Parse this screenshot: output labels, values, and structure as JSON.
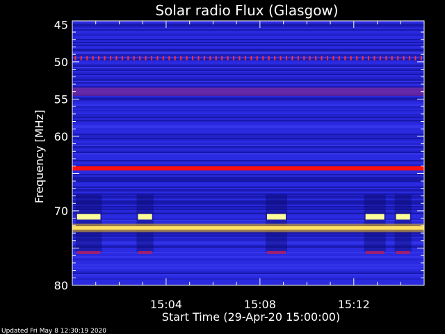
{
  "chart_data": {
    "type": "heatmap",
    "title": "Solar radio Flux (Glasgow)",
    "xlabel": "Start Time (29-Apr-20 15:00:00)",
    "ylabel": "Frequency [MHz]",
    "x_unit": "minutes after 15:00",
    "xlim": [
      0,
      15.0
    ],
    "ylim": [
      80,
      44.5
    ],
    "y_reversed": true,
    "x_ticks": [
      {
        "value": 4,
        "label": "15:04"
      },
      {
        "value": 8,
        "label": "15:08"
      },
      {
        "value": 12,
        "label": "15:12"
      }
    ],
    "y_ticks": [
      {
        "value": 45,
        "label": "45"
      },
      {
        "value": 50,
        "label": "50"
      },
      {
        "value": 55,
        "label": "55"
      },
      {
        "value": 60,
        "label": "60"
      },
      {
        "value": 70,
        "label": "70"
      },
      {
        "value": 80,
        "label": "80"
      }
    ],
    "background_color": "#2a2ae0",
    "bands": [
      {
        "freq": 54.0,
        "color": "#7a2a9a",
        "intensity": "medium"
      },
      {
        "freq": 64.3,
        "color": "#ff1010",
        "intensity": "high"
      },
      {
        "freq": 72.3,
        "color": "#ffe060",
        "intensity": "very high"
      }
    ],
    "periodic_spikes": {
      "freq": 49.5,
      "color": "#ff3030"
    },
    "bursts": [
      {
        "start": 0.2,
        "end": 1.2,
        "freq": 70.8,
        "color": "#ffff99"
      },
      {
        "start": 2.8,
        "end": 3.4,
        "freq": 70.8,
        "color": "#ffff99"
      },
      {
        "start": 8.3,
        "end": 9.1,
        "freq": 70.8,
        "color": "#ffff99"
      },
      {
        "start": 12.5,
        "end": 13.3,
        "freq": 70.8,
        "color": "#ffff99"
      },
      {
        "start": 13.8,
        "end": 14.4,
        "freq": 70.8,
        "color": "#ffff99"
      }
    ]
  },
  "footer": {
    "updated": "Updated Fri May  8 12:30:19 2020"
  }
}
